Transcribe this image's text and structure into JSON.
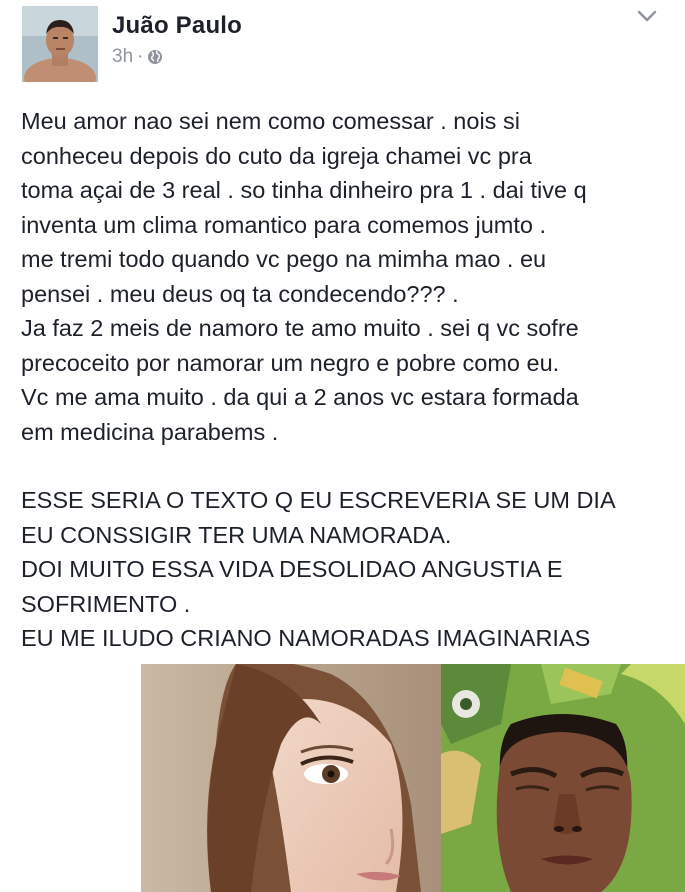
{
  "post": {
    "author": "Juão Paulo",
    "time": "3h",
    "separator": "·",
    "lines": [
      "Meu amor nao sei nem como comessar . nois si",
      "conheceu depois do cuto da igreja chamei vc pra",
      "toma açai de 3 real . so tinha dinheiro pra 1 . dai tive q",
      "inventa um clima romantico para comemos jumto .",
      "me tremi todo quando vc pego na mimha mao . eu",
      "pensei . meu deus oq ta condecendo??? .",
      "Ja faz 2 meis de namoro te amo muito . sei q vc sofre",
      "precoceito por namorar um negro e pobre como eu.",
      "Vc me ama muito . da qui a 2 anos vc estara formada",
      "em medicina parabems .",
      "",
      "ESSE SERIA O TEXTO Q EU ESCREVERIA SE UM DIA",
      "EU CONSSIGIR TER UMA NAMORADA.",
      "DOI MUITO ESSA VIDA DESOLIDAO ANGUSTIA E",
      "SOFRIMENTO .",
      "EU ME ILUDO CRIANO NAMORADAS IMAGINARIAS"
    ]
  },
  "icons": {
    "privacy": "globe-icon",
    "menu": "chevron-down-icon"
  },
  "colors": {
    "text": "#1d2129",
    "meta": "#90949c",
    "background": "#ffffff"
  }
}
